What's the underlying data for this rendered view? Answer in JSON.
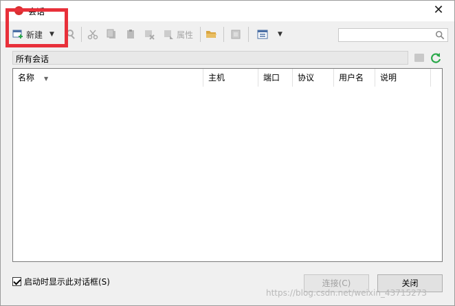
{
  "window": {
    "title": "会话"
  },
  "toolbar": {
    "new_label": "新建",
    "properties_label": "属性"
  },
  "search": {
    "value": ""
  },
  "folder": {
    "label": "所有会话"
  },
  "columns": [
    {
      "label": "名称"
    },
    {
      "label": "主机"
    },
    {
      "label": "端口"
    },
    {
      "label": "协议"
    },
    {
      "label": "用户名"
    },
    {
      "label": "说明"
    }
  ],
  "footer": {
    "checkbox_label": "启动时显示此对话框(S)",
    "checkbox_checked": true,
    "connect_label": "连接(C)",
    "close_label": "关闭"
  },
  "watermark": "https://blog.csdn.net/weixin_43715273",
  "colors": {
    "highlight_box": "#e8303a",
    "refresh_icon": "#2aa84a",
    "new_icon": "#2aa84a"
  }
}
